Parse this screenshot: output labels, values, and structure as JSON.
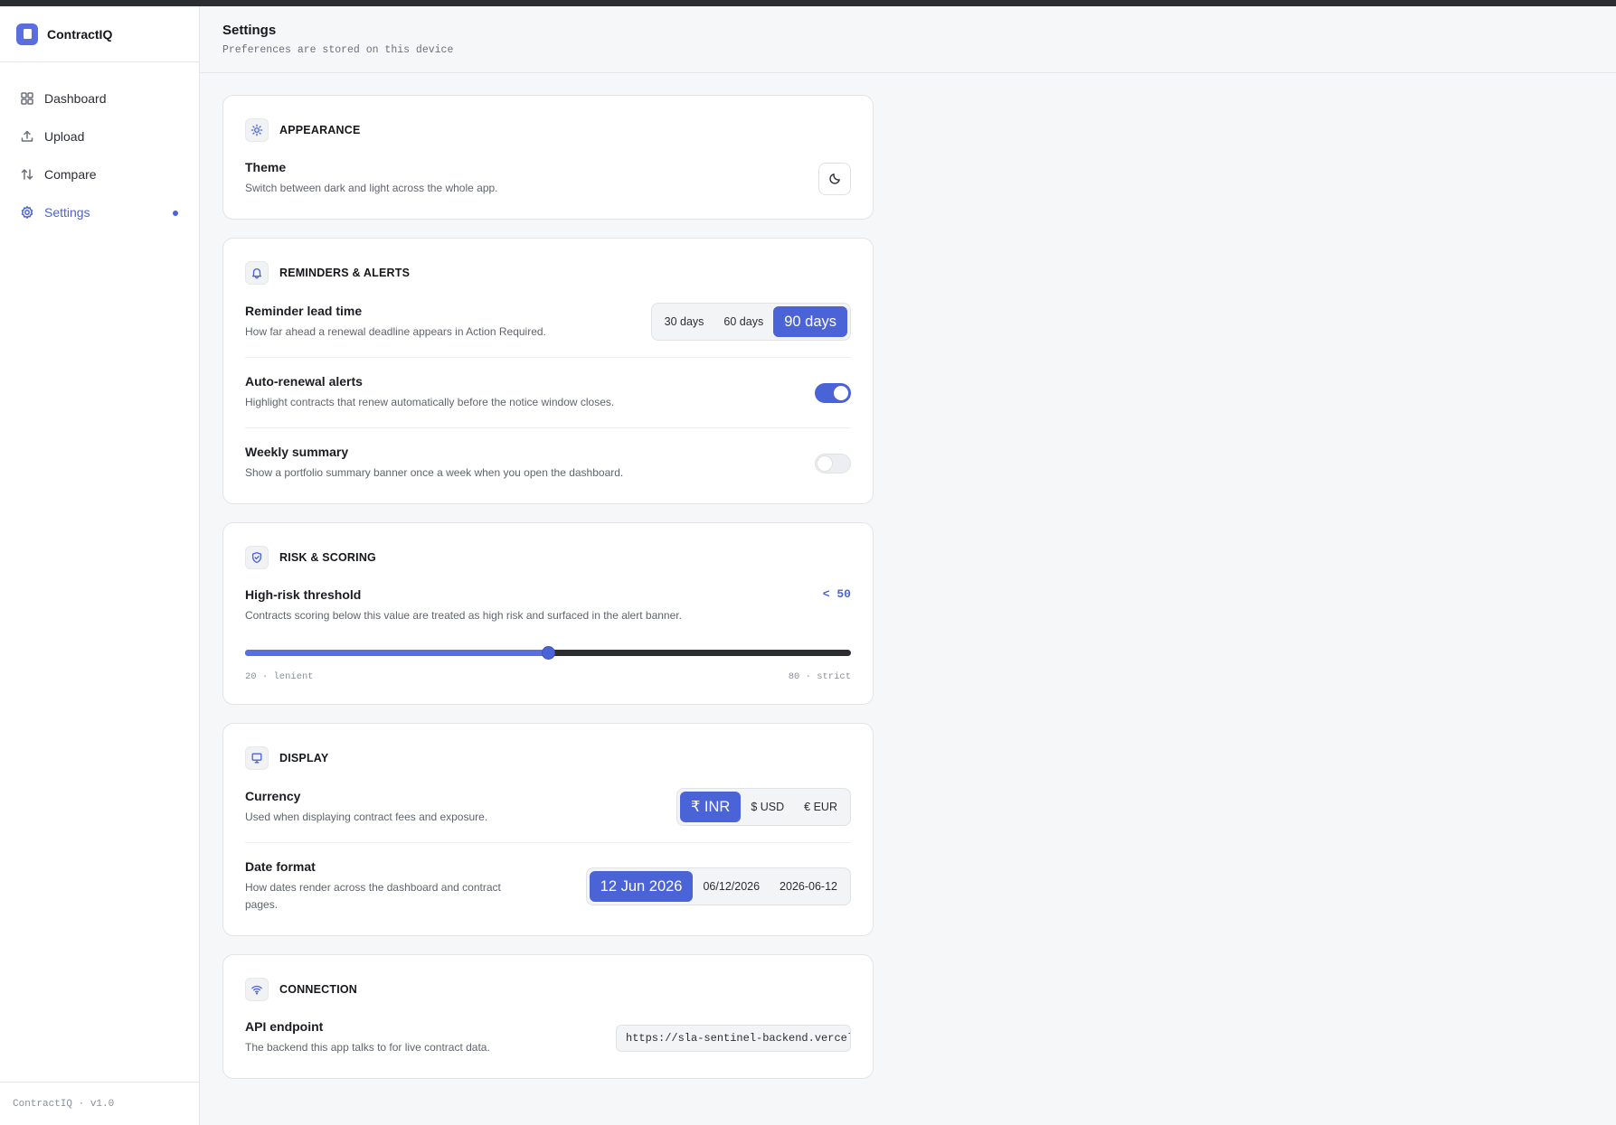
{
  "app": {
    "name": "ContractIQ",
    "version_label": "ContractIQ · v1.0"
  },
  "sidebar": {
    "items": [
      {
        "label": "Dashboard",
        "icon": "grid-icon",
        "active": false
      },
      {
        "label": "Upload",
        "icon": "upload-icon",
        "active": false
      },
      {
        "label": "Compare",
        "icon": "swap-icon",
        "active": false
      },
      {
        "label": "Settings",
        "icon": "gear-icon",
        "active": true
      }
    ]
  },
  "header": {
    "title": "Settings",
    "subtitle": "Preferences are stored on this device"
  },
  "appearance": {
    "title": "APPEARANCE",
    "icon": "sun-icon",
    "theme": {
      "label": "Theme",
      "description": "Switch between dark and light across the whole app.",
      "icon": "moon-icon"
    }
  },
  "reminders": {
    "title": "REMINDERS & ALERTS",
    "icon": "bell-icon",
    "lead_time": {
      "label": "Reminder lead time",
      "description": "How far ahead a renewal deadline appears in Action Required.",
      "options": [
        "30 days",
        "60 days",
        "90 days"
      ],
      "selected": "90 days"
    },
    "auto_renewal": {
      "label": "Auto-renewal alerts",
      "description": "Highlight contracts that renew automatically before the notice window closes.",
      "enabled": true
    },
    "weekly_summary": {
      "label": "Weekly summary",
      "description": "Show a portfolio summary banner once a week when you open the dashboard.",
      "enabled": false
    }
  },
  "risk": {
    "title": "RISK & SCORING",
    "icon": "shield-icon",
    "threshold": {
      "label": "High-risk threshold",
      "description": "Contracts scoring below this value are treated as high risk and surfaced in the alert banner.",
      "value_label": "< 50",
      "value": 50,
      "min": 20,
      "max": 80,
      "min_label": "20 · lenient",
      "max_label": "80 · strict"
    }
  },
  "display": {
    "title": "DISPLAY",
    "icon": "monitor-icon",
    "currency": {
      "label": "Currency",
      "description": "Used when displaying contract fees and exposure.",
      "options": [
        "₹ INR",
        "$ USD",
        "€ EUR"
      ],
      "selected": "₹ INR"
    },
    "date_format": {
      "label": "Date format",
      "description": "How dates render across the dashboard and contract pages.",
      "options": [
        "12 Jun 2026",
        "06/12/2026",
        "2026-06-12"
      ],
      "selected": "12 Jun 2026"
    }
  },
  "connection": {
    "title": "CONNECTION",
    "icon": "wifi-icon",
    "api": {
      "label": "API endpoint",
      "description": "The backend this app talks to for live contract data.",
      "value": "https://sla-sentinel-backend.vercel.app"
    }
  },
  "colors": {
    "accent": "#4a63d6",
    "accent_light": "#5a6ee0",
    "track_dark": "#2b2d31"
  }
}
